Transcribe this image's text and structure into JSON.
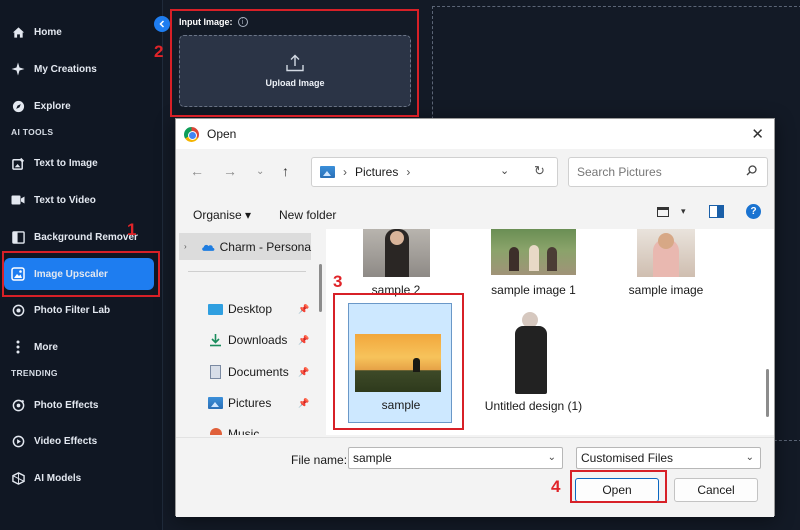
{
  "sidebar": {
    "collapse_icon": "chevron-left-icon",
    "items": [
      {
        "label": "Home",
        "icon": "home-icon"
      },
      {
        "label": "My Creations",
        "icon": "sparkle-icon"
      },
      {
        "label": "Explore",
        "icon": "compass-icon"
      },
      {
        "label": "Text to Image",
        "icon": "image-edit-icon"
      },
      {
        "label": "Text to Video",
        "icon": "video-icon"
      },
      {
        "label": "Background Remover",
        "icon": "split-frame-icon"
      },
      {
        "label": "Image Upscaler",
        "icon": "image-upscale-icon",
        "active": true
      },
      {
        "label": "Photo Filter Lab",
        "icon": "camera-filter-icon"
      },
      {
        "label": "More",
        "icon": "more-vertical-icon"
      },
      {
        "label": "Photo Effects",
        "icon": "photo-effects-icon"
      },
      {
        "label": "Video Effects",
        "icon": "video-effects-icon"
      },
      {
        "label": "AI Models",
        "icon": "ai-models-icon"
      }
    ],
    "section_ai_tools": "AI TOOLS",
    "section_trending": "TRENDING"
  },
  "input_panel": {
    "label": "Input Image:",
    "info_icon": "i",
    "upload_label": "Upload Image"
  },
  "annotations": {
    "step1": "1",
    "step2": "2",
    "step3": "3",
    "step4": "4",
    "color": "#d72027"
  },
  "dialog": {
    "title": "Open",
    "address": {
      "location": "Pictures",
      "separator": "›"
    },
    "search_placeholder": "Search Pictures",
    "organise": "Organise ▾",
    "new_folder": "New folder",
    "nav": {
      "cloud": "Charm - Persona",
      "quick_access": [
        {
          "label": "Desktop",
          "icon": "desktop-icon"
        },
        {
          "label": "Downloads",
          "icon": "download-icon"
        },
        {
          "label": "Documents",
          "icon": "documents-icon"
        },
        {
          "label": "Pictures",
          "icon": "pictures-icon"
        },
        {
          "label": "Music",
          "icon": "music-icon"
        }
      ]
    },
    "files": [
      {
        "name": "sample 2"
      },
      {
        "name": "sample image 1"
      },
      {
        "name": "sample image"
      },
      {
        "name": "sample",
        "selected": true
      },
      {
        "name": "Untitled design (1)"
      }
    ],
    "file_name_label": "File name:",
    "file_name_value": "sample",
    "file_type": "Customised Files",
    "open_label": "Open",
    "cancel_label": "Cancel"
  }
}
